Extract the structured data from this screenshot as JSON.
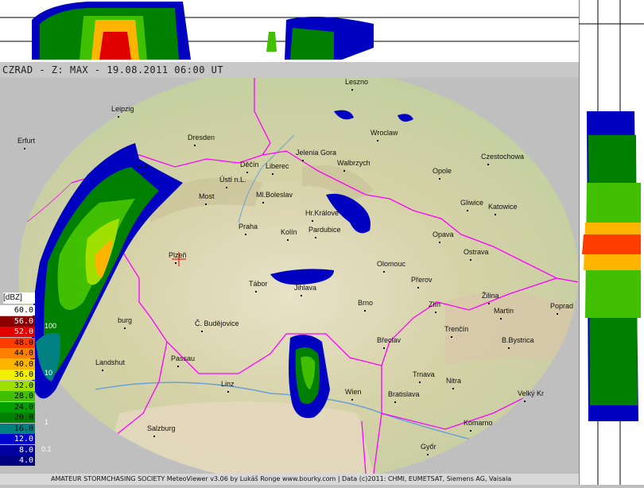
{
  "title": "CZRAD - Z: MAX - 19.08.2011 06:00 UT",
  "footer": "AMATEUR STORMCHASING SOCIETY MeteoViewer v3.06 by Lukáš Ronge www.bourky.com | Data (c)2011: CHMI, EUMETSAT, Siemens AG, Vaisala",
  "legend": {
    "title": "[dBZ]",
    "levels": [
      {
        "label": "60.0",
        "color": "#ffffff",
        "text": "#000"
      },
      {
        "label": "56.0",
        "color": "#8b0000",
        "text": "#fff"
      },
      {
        "label": "52.0",
        "color": "#e00000",
        "text": "#fff"
      },
      {
        "label": "48.0",
        "color": "#ff3c00",
        "text": "#000"
      },
      {
        "label": "44.0",
        "color": "#ff8000",
        "text": "#000"
      },
      {
        "label": "40.0",
        "color": "#ffb400",
        "text": "#000"
      },
      {
        "label": "36.0",
        "color": "#f0f000",
        "text": "#000"
      },
      {
        "label": "32.0",
        "color": "#a0e000",
        "text": "#000"
      },
      {
        "label": "28.0",
        "color": "#40c000",
        "text": "#000"
      },
      {
        "label": "24.0",
        "color": "#00a000",
        "text": "#000"
      },
      {
        "label": "20.0",
        "color": "#008000",
        "text": "#000"
      },
      {
        "label": "16.0",
        "color": "#008080",
        "text": "#000"
      },
      {
        "label": "12.0",
        "color": "#0000d0",
        "text": "#fff"
      },
      {
        "label": "8.0",
        "color": "#0000a0",
        "text": "#fff"
      },
      {
        "label": "4.0",
        "color": "#000080",
        "text": "#fff"
      }
    ],
    "rain_rates": [
      "100",
      "10",
      "1",
      "0.1"
    ]
  },
  "cities": [
    {
      "name": "Leszno"
    },
    {
      "name": "Leipzig"
    },
    {
      "name": "Erfurt"
    },
    {
      "name": "Dresden"
    },
    {
      "name": "Wroclaw"
    },
    {
      "name": "Jelenia Gora"
    },
    {
      "name": "Czestochowa"
    },
    {
      "name": "Walbrzych"
    },
    {
      "name": "Liberec"
    },
    {
      "name": "Děčín"
    },
    {
      "name": "Ústí n.L."
    },
    {
      "name": "Opole"
    },
    {
      "name": "Most"
    },
    {
      "name": "Ml.Boleslav"
    },
    {
      "name": "Gliwice"
    },
    {
      "name": "Katowice"
    },
    {
      "name": "Hr.Králové"
    },
    {
      "name": "Praha"
    },
    {
      "name": "Kolín"
    },
    {
      "name": "Pardubice"
    },
    {
      "name": "Opava"
    },
    {
      "name": "Plzeň"
    },
    {
      "name": "Ostrava"
    },
    {
      "name": "Olomouc"
    },
    {
      "name": "Přerov"
    },
    {
      "name": "Tábor"
    },
    {
      "name": "Jihlava"
    },
    {
      "name": "Brno"
    },
    {
      "name": "Zlín"
    },
    {
      "name": "Žilina"
    },
    {
      "name": "Martin"
    },
    {
      "name": "Poprad"
    },
    {
      "name": "Č. Budějovice"
    },
    {
      "name": "Trenčín"
    },
    {
      "name": "Břeclav"
    },
    {
      "name": "Passau"
    },
    {
      "name": "B.Bystrica"
    },
    {
      "name": "Landshut"
    },
    {
      "name": "Trnava"
    },
    {
      "name": "Nitra"
    },
    {
      "name": "Linz"
    },
    {
      "name": "Wien"
    },
    {
      "name": "Bratislava"
    },
    {
      "name": "Velký Kr"
    },
    {
      "name": "Salzburg"
    },
    {
      "name": "Komarno"
    },
    {
      "name": "Győr"
    },
    {
      "name": "burg"
    },
    {
      "name": "sau"
    }
  ]
}
